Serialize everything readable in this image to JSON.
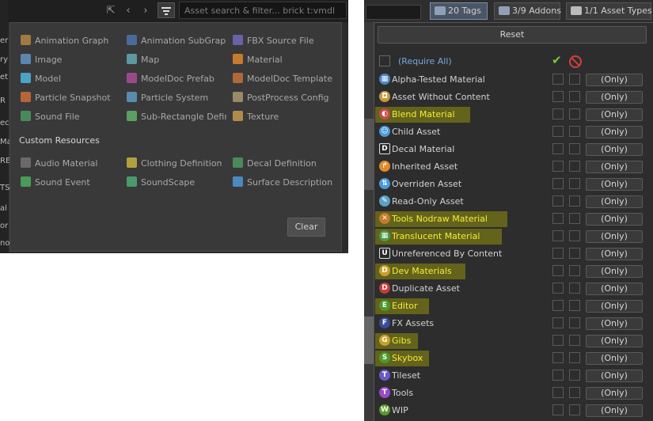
{
  "left_panel": {
    "search_placeholder": "Asset search & filter... brick t:vmdl",
    "nav": [
      "⇱",
      "‹",
      "›"
    ],
    "edge_text": [
      "er",
      "ry",
      "et",
      "R",
      "ec",
      "Ma",
      "RE",
      "TS",
      "al",
      "or",
      "no"
    ],
    "asset_types": [
      {
        "label": "Animation Graph",
        "color": "#a07a40"
      },
      {
        "label": "Animation SubGraph",
        "color": "#4a6a9a"
      },
      {
        "label": "FBX Source File",
        "color": "#6a62a8"
      },
      {
        "label": "Image",
        "color": "#5b86b0"
      },
      {
        "label": "Map",
        "color": "#5a9aa0"
      },
      {
        "label": "Material",
        "color": "#c77b2e"
      },
      {
        "label": "Model",
        "color": "#4aa2c8"
      },
      {
        "label": "ModelDoc Prefab",
        "color": "#9a4a8a"
      },
      {
        "label": "ModelDoc Template",
        "color": "#b0683a"
      },
      {
        "label": "Particle Snapshot",
        "color": "#b8643a"
      },
      {
        "label": "Particle System",
        "color": "#5a8ab0"
      },
      {
        "label": "PostProcess Config",
        "color": "#9a8a6a"
      },
      {
        "label": "Sound File",
        "color": "#4a8a5a"
      },
      {
        "label": "Sub-Rectangle Definit",
        "color": "#5aa060"
      },
      {
        "label": "Texture",
        "color": "#b08a4a"
      }
    ],
    "custom_resources_label": "Custom Resources",
    "custom_resources": [
      {
        "label": "Audio Material",
        "color": "#6a6a6a"
      },
      {
        "label": "Clothing Definition",
        "color": "#b0a040"
      },
      {
        "label": "Decal Definition",
        "color": "#4a8a5a"
      },
      {
        "label": "Sound Event",
        "color": "#4a9a5a"
      },
      {
        "label": "SoundScape",
        "color": "#4a9a6a"
      },
      {
        "label": "Surface Description",
        "color": "#4a8ac0"
      }
    ],
    "clear_label": "Clear"
  },
  "toolbar": {
    "tags_label": "20 Tags",
    "addons_label": "3/9 Addons",
    "asset_types_label": "1/1 Asset Types"
  },
  "tag_panel": {
    "reset_label": "Reset",
    "require_all_label": "(Require All)",
    "only_label": "(Only)",
    "tags": [
      {
        "label": "Alpha-Tested Material",
        "icon": "checker-icon",
        "glyph": "▦",
        "color": "#4a86c8",
        "highlighted": false
      },
      {
        "label": "Asset Without Content",
        "icon": "lock-icon",
        "glyph": "◘",
        "color": "#c89a3a",
        "highlighted": false
      },
      {
        "label": "Blend Material",
        "icon": "blend-icon",
        "glyph": "◐",
        "color": "#c84a4a",
        "highlighted": true
      },
      {
        "label": "Child Asset",
        "icon": "child-icon",
        "glyph": "☺",
        "color": "#4a9ad8",
        "highlighted": false
      },
      {
        "label": "Decal Material",
        "icon": "decal-icon",
        "glyph": "D",
        "color": "#2a2a2a",
        "highlighted": false
      },
      {
        "label": "Inherited Asset",
        "icon": "inherit-icon",
        "glyph": "↱",
        "color": "#e08a2a",
        "highlighted": false
      },
      {
        "label": "Overriden Asset",
        "icon": "override-icon",
        "glyph": "⇅",
        "color": "#4a9ae0",
        "highlighted": false
      },
      {
        "label": "Read-Only Asset",
        "icon": "readonly-icon",
        "glyph": "✎",
        "color": "#5aa0c8",
        "highlighted": false
      },
      {
        "label": "Tools Nodraw Material",
        "icon": "nodraw-icon",
        "glyph": "✕",
        "color": "#c87a2a",
        "highlighted": true
      },
      {
        "label": "Translucent Material",
        "icon": "translucent-icon",
        "glyph": "▦",
        "color": "#4a9a4a",
        "highlighted": true
      },
      {
        "label": "Unreferenced By Content",
        "icon": "unreferenced-icon",
        "glyph": "U",
        "color": "#2a2a2a",
        "highlighted": false
      },
      {
        "label": "Dev Materials",
        "icon": "letter-d-icon",
        "glyph": "D",
        "color": "#c8a02a",
        "highlighted": true
      },
      {
        "label": "Duplicate Asset",
        "icon": "letter-d-icon",
        "glyph": "D",
        "color": "#c83a3a",
        "highlighted": false
      },
      {
        "label": "Editor",
        "icon": "letter-e-icon",
        "glyph": "E",
        "color": "#4a9a2a",
        "highlighted": true
      },
      {
        "label": "FX Assets",
        "icon": "letter-f-icon",
        "glyph": "F",
        "color": "#3a4a9a",
        "highlighted": false
      },
      {
        "label": "Gibs",
        "icon": "letter-g-icon",
        "glyph": "G",
        "color": "#c8a02a",
        "highlighted": true
      },
      {
        "label": "Skybox",
        "icon": "letter-s-icon",
        "glyph": "S",
        "color": "#4a9a2a",
        "highlighted": true
      },
      {
        "label": "Tileset",
        "icon": "letter-t-icon",
        "glyph": "T",
        "color": "#6a5ac8",
        "highlighted": false
      },
      {
        "label": "Tools",
        "icon": "letter-t-icon",
        "glyph": "T",
        "color": "#9a4ac8",
        "highlighted": false
      },
      {
        "label": "WIP",
        "icon": "letter-w-icon",
        "glyph": "W",
        "color": "#5a9a2a",
        "highlighted": false
      }
    ]
  }
}
